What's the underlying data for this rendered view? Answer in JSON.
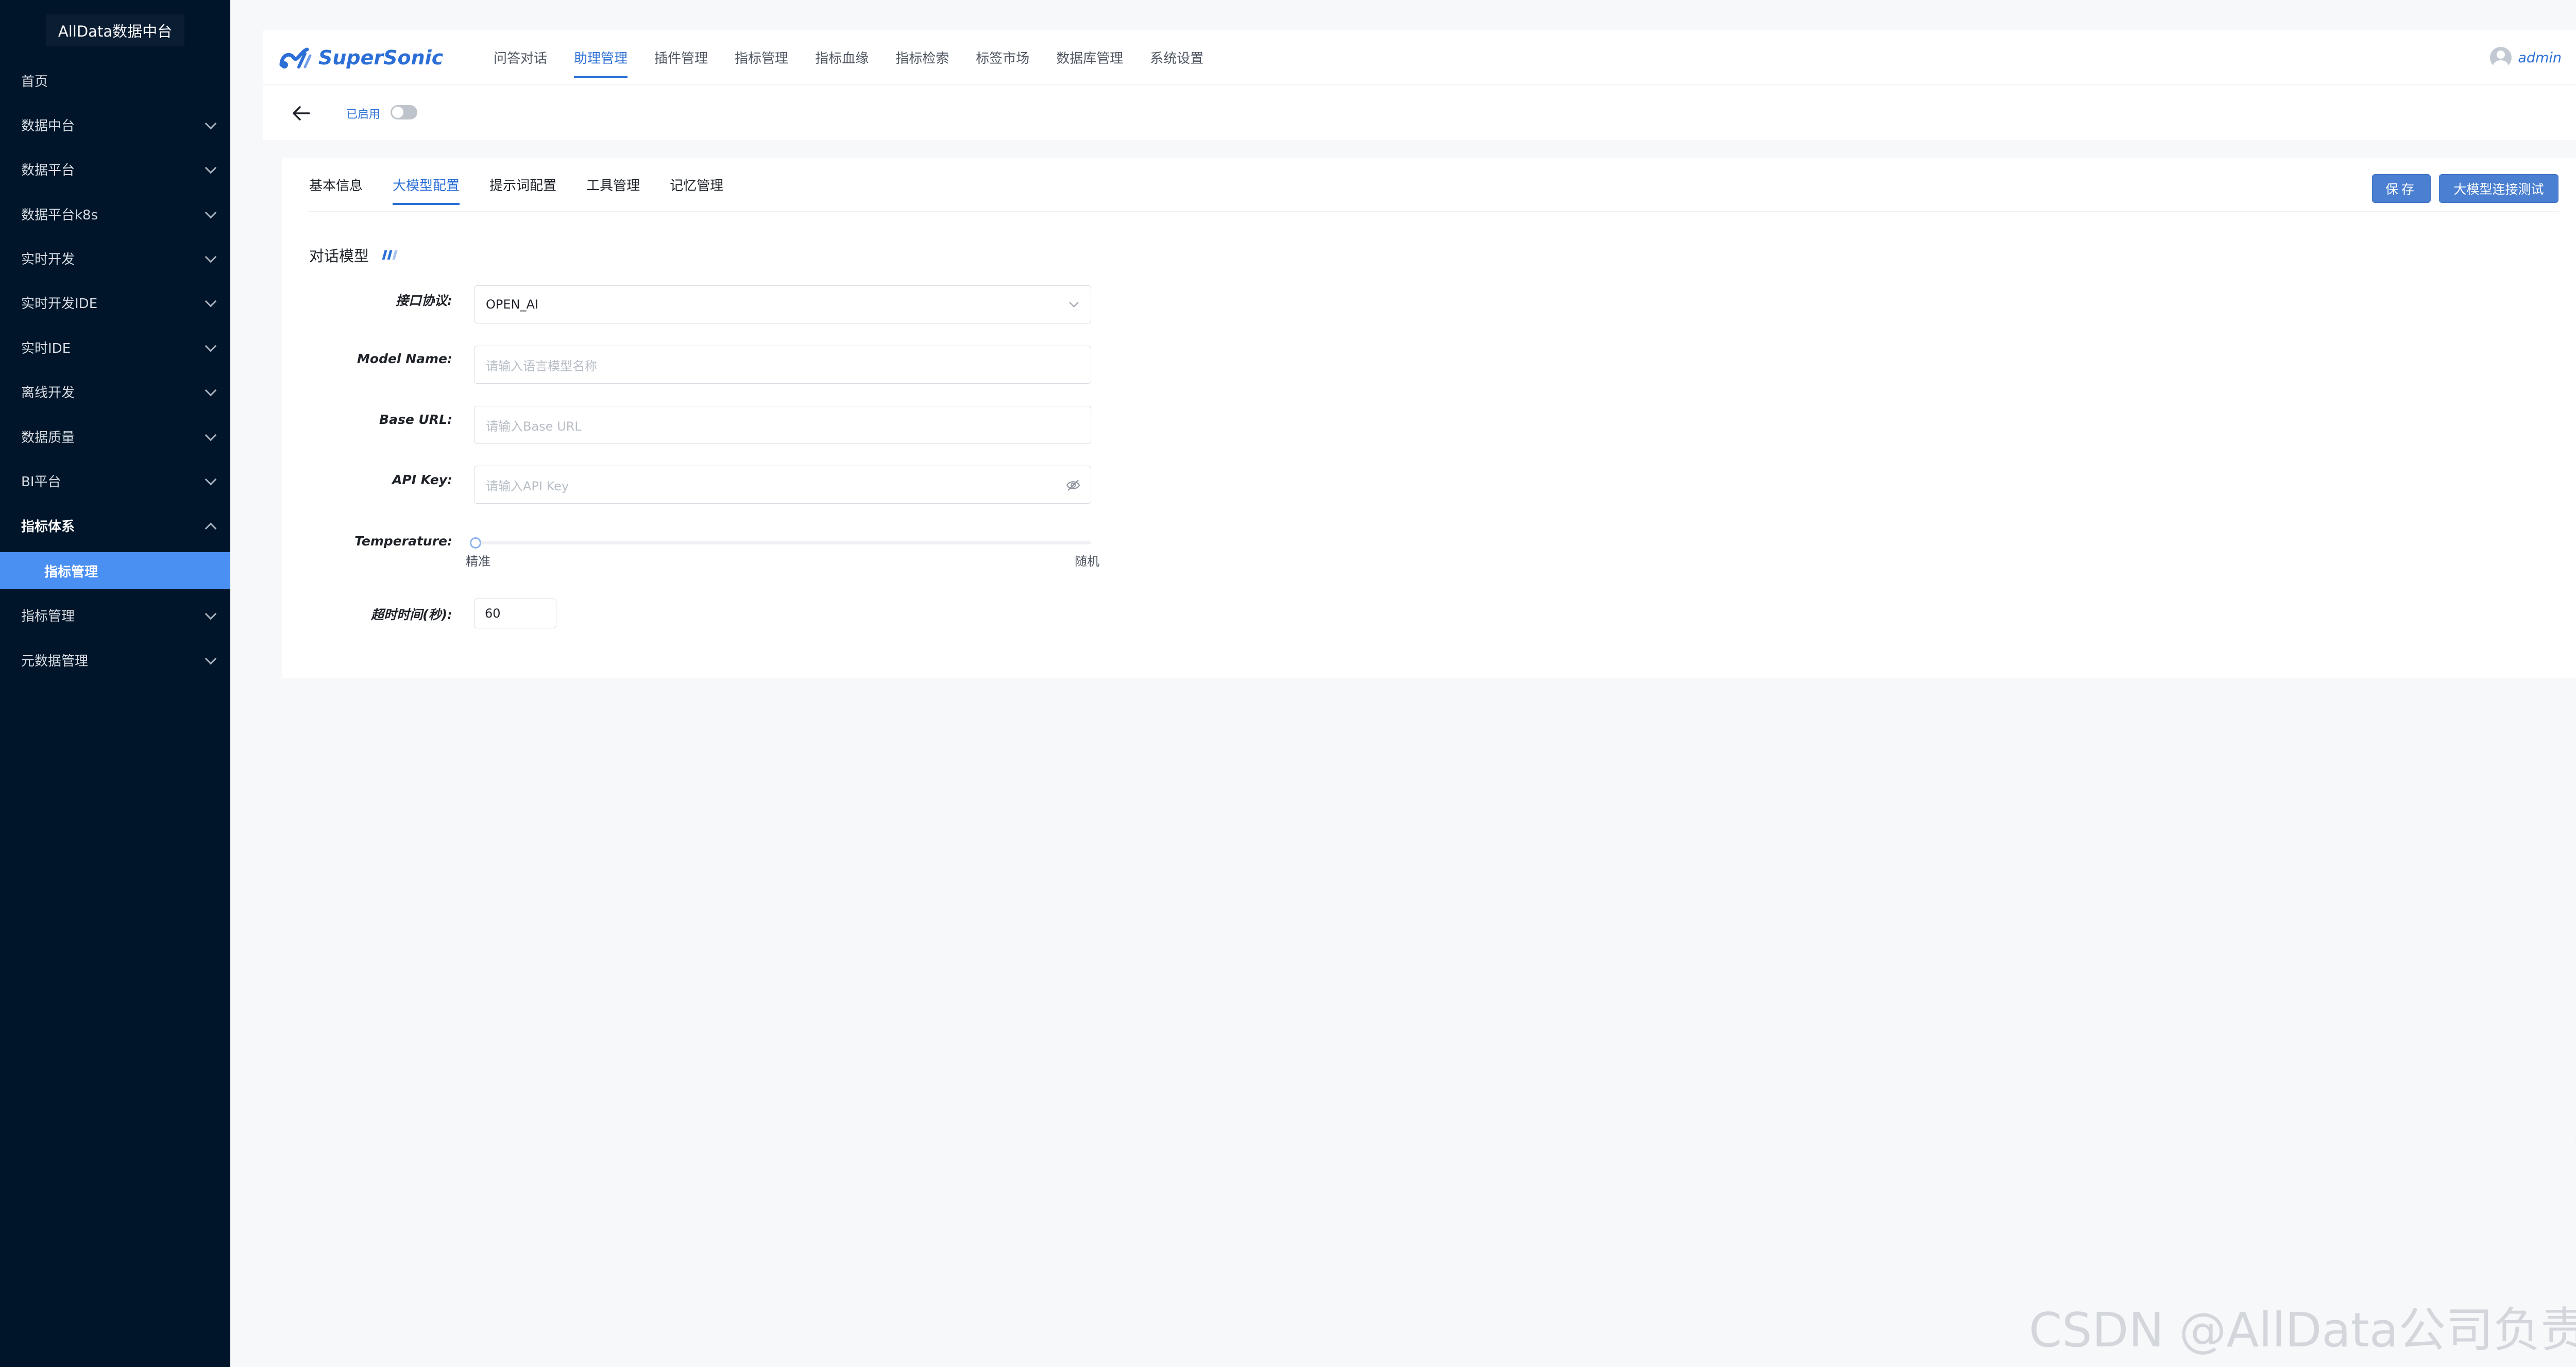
{
  "sidebar": {
    "title": "AllData数据中台",
    "items": [
      {
        "label": "首页"
      },
      {
        "label": "数据中台"
      },
      {
        "label": "数据平台"
      },
      {
        "label": "数据平台k8s"
      },
      {
        "label": "实时开发"
      },
      {
        "label": "实时开发IDE"
      },
      {
        "label": "实时IDE"
      },
      {
        "label": "离线开发"
      },
      {
        "label": "数据质量"
      },
      {
        "label": "BI平台"
      },
      {
        "label": "指标体系"
      },
      {
        "label": "指标管理"
      },
      {
        "label": "指标管理"
      },
      {
        "label": "元数据管理"
      }
    ]
  },
  "header": {
    "logo_text": "SuperSonic",
    "nav": [
      {
        "label": "问答对话"
      },
      {
        "label": "助理管理"
      },
      {
        "label": "插件管理"
      },
      {
        "label": "指标管理"
      },
      {
        "label": "指标血缘"
      },
      {
        "label": "指标检索"
      },
      {
        "label": "标签市场"
      },
      {
        "label": "数据库管理"
      },
      {
        "label": "系统设置"
      }
    ],
    "active_nav": "助理管理",
    "user": "admin"
  },
  "subbar": {
    "enabled_label": "已启用"
  },
  "tabs": [
    {
      "label": "基本信息"
    },
    {
      "label": "大模型配置"
    },
    {
      "label": "提示词配置"
    },
    {
      "label": "工具管理"
    },
    {
      "label": "记忆管理"
    }
  ],
  "actions": {
    "save": "保存",
    "test": "大模型连接测试"
  },
  "form": {
    "section_title": "对话模型",
    "protocol_label": "接口协议:",
    "protocol_value": "OPEN_AI",
    "model_name_label": "Model Name:",
    "model_name_placeholder": "请输入语言模型名称",
    "base_url_label": "Base URL:",
    "base_url_placeholder": "请输入Base URL",
    "api_key_label": "API Key:",
    "api_key_placeholder": "请输入API Key",
    "temperature_label": "Temperature:",
    "temperature_value": 0,
    "temperature_min_label": "精准",
    "temperature_max_label": "随机",
    "timeout_label": "超时时间(秒):",
    "timeout_value": "60"
  },
  "colors": {
    "sidebar_bg": "#001529",
    "accent": "#2b6fd6",
    "active_item": "#4a8ff2",
    "button": "#4a7fd1"
  },
  "watermark": "CSDN @AllData公司负责人"
}
